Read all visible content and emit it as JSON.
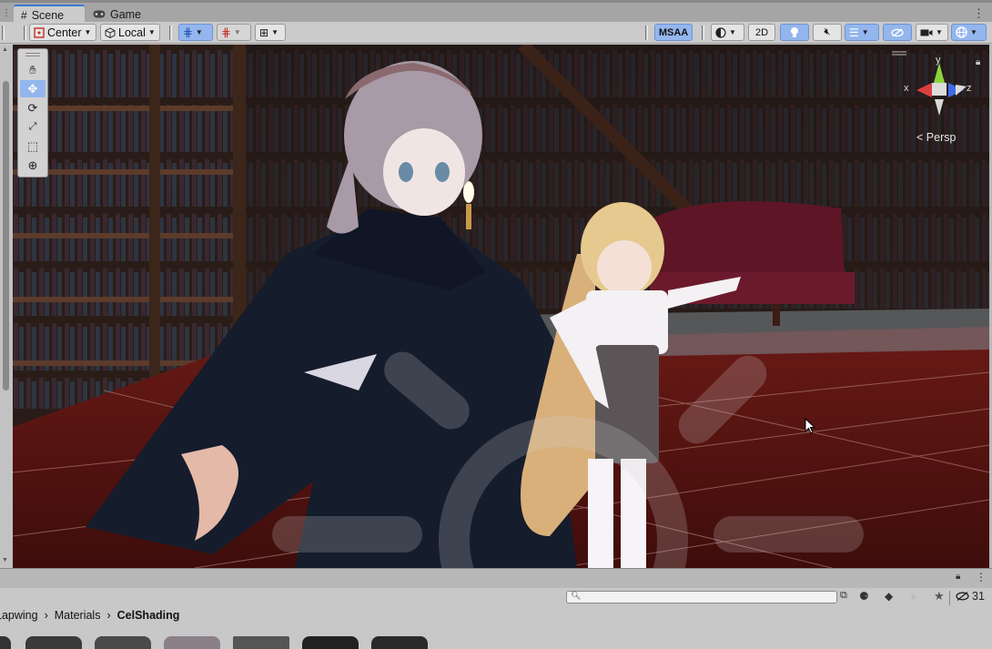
{
  "tabs": [
    {
      "label": "Scene",
      "icon": "grid-hash-icon"
    },
    {
      "label": "Game",
      "icon": "gamepad-icon"
    }
  ],
  "toolbar": {
    "pivot": "Center",
    "space": "Local",
    "msaa": "MSAA",
    "mode_2d": "2D"
  },
  "viewport": {
    "axis_y": "y",
    "axis_x": "x",
    "axis_z": "z",
    "projection": "Persp"
  },
  "tools": [
    "hand-tool",
    "move-tool",
    "rotate-tool",
    "scale-tool",
    "rect-tool",
    "transform-tool"
  ],
  "project": {
    "breadcrumb": [
      "Lapwing",
      "Materials",
      "CelShading"
    ],
    "hidden_count": "31",
    "search_value": ""
  },
  "colors": {
    "accent": "#3a79d8",
    "active": "#93b6ee",
    "floor": "#5a1512",
    "panel": "#c8c8c8"
  }
}
